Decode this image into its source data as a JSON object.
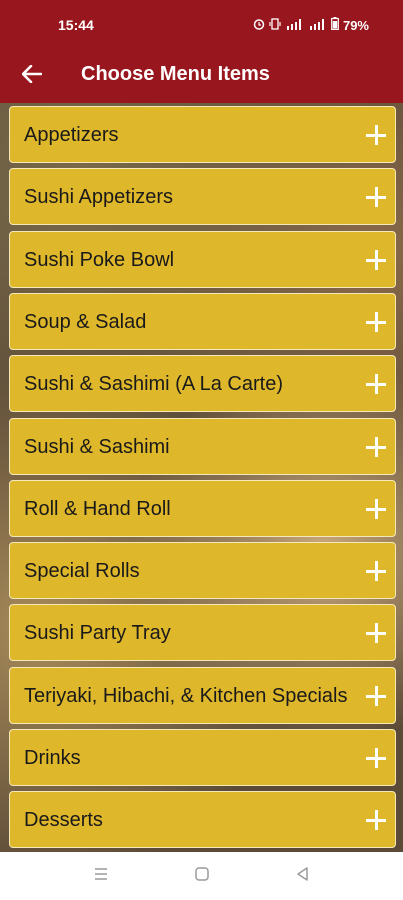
{
  "status_bar": {
    "time": "15:44",
    "battery": "79%",
    "icons": [
      "alarm-icon",
      "vibrate-icon",
      "lte-signal-icon",
      "signal-icon",
      "battery-icon"
    ]
  },
  "app_bar": {
    "title": "Choose Menu Items",
    "back_icon": "arrow-left-icon",
    "color": "#98161d"
  },
  "menu": {
    "item_color": "#dfb72b",
    "expand_icon": "plus-icon",
    "items": [
      {
        "label": "Appetizers"
      },
      {
        "label": "Sushi Appetizers"
      },
      {
        "label": "Sushi Poke Bowl"
      },
      {
        "label": "Soup & Salad"
      },
      {
        "label": "Sushi & Sashimi (A La Carte)"
      },
      {
        "label": "Sushi & Sashimi"
      },
      {
        "label": "Roll & Hand Roll"
      },
      {
        "label": "Special Rolls"
      },
      {
        "label": "Sushi Party Tray"
      },
      {
        "label": "Teriyaki, Hibachi, & Kitchen Specials"
      },
      {
        "label": "Drinks"
      },
      {
        "label": "Desserts"
      }
    ]
  },
  "nav_bar": {
    "icons": [
      "menu-icon",
      "home-square-icon",
      "back-triangle-icon"
    ]
  }
}
